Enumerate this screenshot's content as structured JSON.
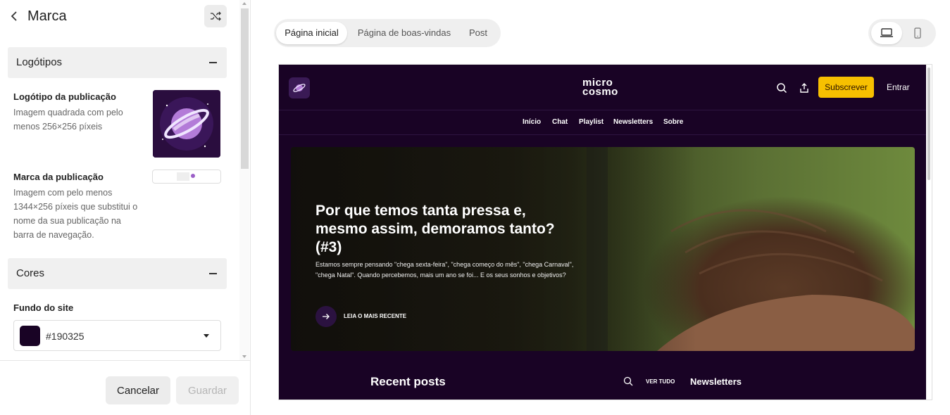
{
  "panel": {
    "title": "Marca",
    "sections": {
      "logos": "Logótipos",
      "colors": "Cores"
    },
    "publication_logo": {
      "title": "Logótipo da publicação",
      "description": "Imagem quadrada com pelo menos 256×256 píxeis"
    },
    "publication_brand": {
      "title": "Marca da publicação",
      "description": "Imagem com pelo menos 1344×256 píxeis que substitui o nome da sua publicação na barra de navegação."
    },
    "site_background": {
      "title": "Fundo do site",
      "value": "#190325"
    },
    "buttons": {
      "cancel": "Cancelar",
      "save": "Guardar"
    }
  },
  "preview_tabs": [
    "Página inicial",
    "Página de boas-vindas",
    "Post"
  ],
  "device_toggle": [
    "desktop-icon",
    "mobile-icon"
  ],
  "site": {
    "logo_text": [
      "micro",
      "cosmo"
    ],
    "subscribe": "Subscrever",
    "login": "Entrar",
    "nav": [
      "Início",
      "Chat",
      "Playlist",
      "Newsletters",
      "Sobre"
    ],
    "hero": {
      "title": "Por que temos tanta pressa e, mesmo assim, demoramos tanto? (#3)",
      "description": "Estamos sempre pensando \"chega sexta-feira\", \"chega começo do mês\", \"chega Carnaval\", \"chega Natal\". Quando percebemos, mais um ano se foi... E os seus sonhos e objetivos?",
      "cta": "LEIA O MAIS RECENTE"
    },
    "recent_posts": "Recent posts",
    "see_all": "VER TUDO",
    "newsletters_heading": "Newsletters"
  },
  "colors": {
    "site_background": "#190325",
    "accent": "#f7c000"
  }
}
